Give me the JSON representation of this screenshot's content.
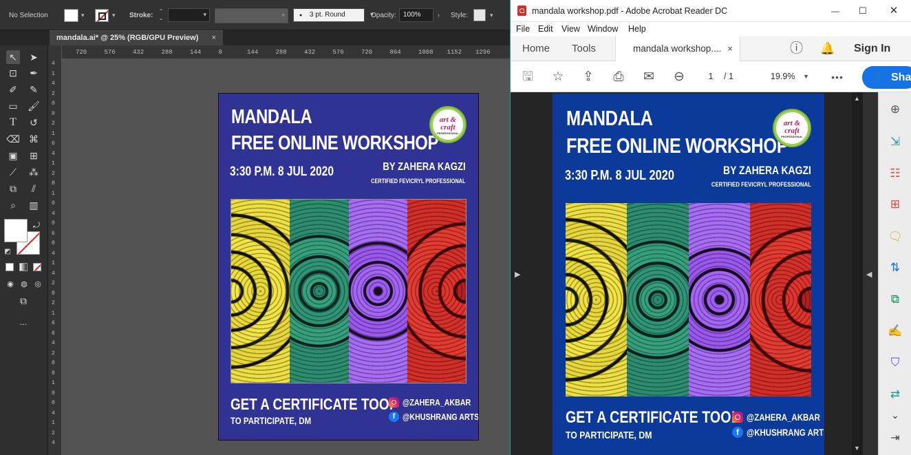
{
  "illustrator": {
    "control_bar": {
      "selection": "No Selection",
      "stroke_label": "Stroke:",
      "brush": "3 pt. Round",
      "opacity_label": "Opacity:",
      "opacity": "100%",
      "style_label": "Style:"
    },
    "doc_tab": {
      "title": "mandala.ai* @ 25% (RGB/GPU Preview)",
      "close": "×"
    },
    "ruler_top": [
      "720",
      "576",
      "432",
      "288",
      "144",
      "0",
      "144",
      "288",
      "432",
      "576",
      "720",
      "864",
      "1008",
      "1152",
      "1296"
    ],
    "ruler_left": [
      "4",
      "1",
      "4",
      "2",
      "0",
      "0",
      "2",
      "1",
      "6",
      "4",
      "1",
      "2",
      "8",
      "1",
      "0",
      "4",
      "0",
      "6",
      "0",
      "4",
      "1",
      "4",
      "2",
      "0",
      "2",
      "1",
      "6",
      "6",
      "4",
      "2",
      "8",
      "8",
      "1",
      "0",
      "0",
      "4",
      "1",
      "2",
      "4"
    ],
    "more": "..."
  },
  "poster": {
    "title_line1": "MANDALA",
    "title_line2": "FREE ONLINE WORKSHOP",
    "datetime": "3:30 P.M. 8 JUL 2020",
    "by": "BY ZAHERA KAGZI",
    "by_sub": "CERTIFIED FEVICRYL PROFESSIONAL",
    "logo_text": "art & craft",
    "logo_sub": "PROFESSIONAL",
    "certificate": "GET A CERTIFICATE TOO!",
    "participate": "TO PARTICIPATE, DM",
    "instagram": "@ZAHERA_AKBAR",
    "facebook": "@KHUSHRANG ARTS",
    "panels": [
      "yellow",
      "green",
      "purple",
      "red"
    ],
    "colors": {
      "ai_bg": "#303394",
      "pdf_bg": "#0b3a9a"
    }
  },
  "acrobat": {
    "window_title": "mandala workshop.pdf - Adobe Acrobat Reader DC",
    "menu": [
      "File",
      "Edit",
      "View",
      "Window",
      "Help"
    ],
    "nav": {
      "home": "Home",
      "tools": "Tools",
      "doc_tab": "mandala workshop....",
      "close": "×",
      "sign_in": "Sign In"
    },
    "page_current": "1",
    "page_total": "/ 1",
    "zoom": "19.9%",
    "more": "•••",
    "share": "Sha",
    "window_buttons": {
      "min": "—",
      "max": "☐",
      "close": "✕"
    }
  }
}
